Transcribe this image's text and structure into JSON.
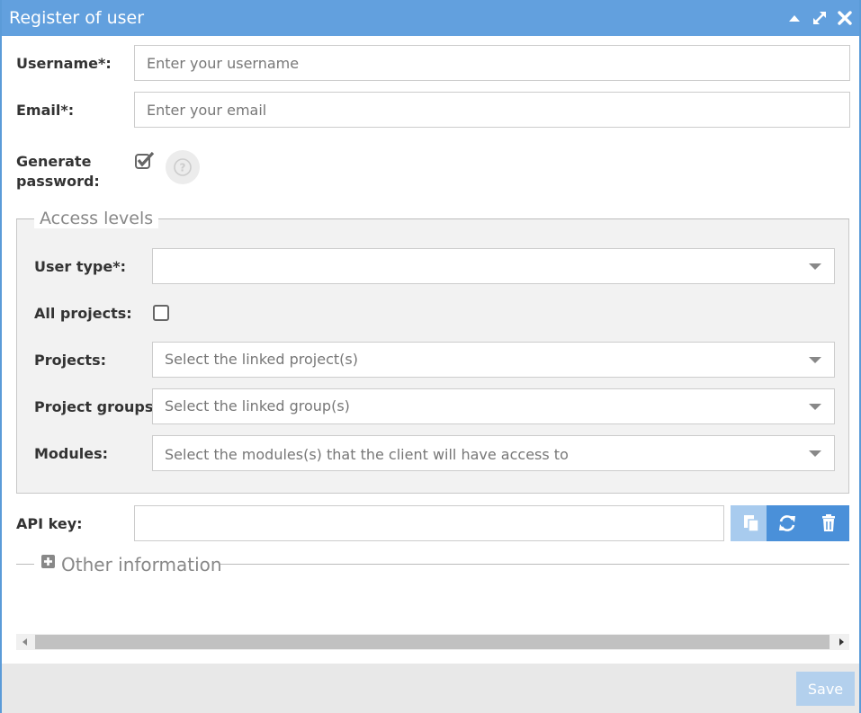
{
  "window": {
    "title": "Register of user",
    "title_color": "#62a0de",
    "icons": [
      "caret-up-icon",
      "expand-icon",
      "close-icon"
    ]
  },
  "form": {
    "username": {
      "label": "Username*:",
      "placeholder": "Enter your username",
      "value": ""
    },
    "email": {
      "label": "Email*:",
      "placeholder": "Enter your email",
      "value": ""
    },
    "generate_password": {
      "label_line1": "Generate",
      "label_line2": "password:",
      "checked": true
    },
    "access_levels": {
      "legend": "Access levels",
      "user_type": {
        "label": "User type*:",
        "value": ""
      },
      "all_projects": {
        "label": "All projects:",
        "checked": false
      },
      "projects": {
        "label": "Projects:",
        "placeholder": "Select the linked project(s)"
      },
      "project_groups": {
        "label": "Project groups:",
        "placeholder": "Select the linked group(s)"
      },
      "modules": {
        "label": "Modules:",
        "placeholder": "Select the modules(s) that the client will have access to"
      }
    },
    "api_key": {
      "label": "API key:",
      "value": "",
      "buttons": [
        "copy-icon",
        "refresh-icon",
        "trash-icon"
      ],
      "button_color": "#4a90d9",
      "button_disabled_color": "#a8cbee"
    },
    "other_information": {
      "label": "Other information",
      "collapsed": true
    }
  },
  "footer": {
    "save_label": "Save",
    "save_color": "#b3d0ed"
  }
}
